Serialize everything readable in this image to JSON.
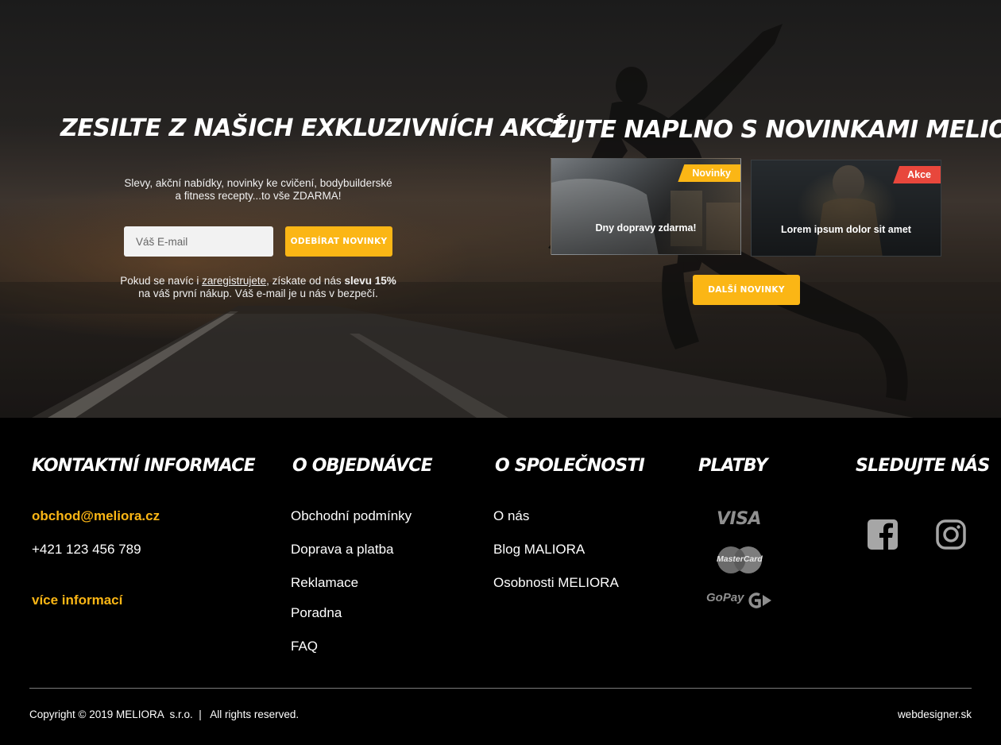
{
  "hero": {
    "left": {
      "title": "Zesilte z našich exkluzivních akcí",
      "description_line1": "Slevy, akční nabídky, novinky ke cvičení, bodybuilderské",
      "description_line2": "a fitness recepty...to vše ZDARMA!",
      "email_placeholder": "Váš E-mail",
      "subscribe_label": "Odebírat novinky",
      "note_prefix": "Pokud se navíc i ",
      "note_link": "zaregistrujete",
      "note_middle": ", získate od nás ",
      "note_bold": "slevu 15%",
      "note_line2": "na váš první nákup. Váš e-mail je u nás v bezpečí."
    },
    "right": {
      "title": "Žijte naplno s novinkami MELIORA",
      "cards": [
        {
          "tag": "Novinky",
          "tag_color": "#fbb615",
          "title": "Dny dopravy zdarma!"
        },
        {
          "tag": "Akce",
          "tag_color": "#e8473c",
          "title": "Lorem ipsum dolor sit amet"
        }
      ],
      "more_label": "Další novinky"
    }
  },
  "footer": {
    "contact": {
      "heading": "Kontaktní informace",
      "email": "obchod@meliora.cz",
      "phone": "+421 123 456 789",
      "more": "více informací"
    },
    "order": {
      "heading": "O objednávce",
      "links": [
        "Obchodní podmínky",
        "Doprava a platba",
        "Reklamace",
        "Poradna",
        "FAQ"
      ]
    },
    "company": {
      "heading": "O společnosti",
      "links": [
        "O nás",
        "Blog MALIORA",
        "Osobnosti MELIORA"
      ]
    },
    "payments": {
      "heading": "Platby",
      "icons": [
        "visa-icon",
        "mastercard-icon",
        "gopay-icon"
      ],
      "visa": "VISA",
      "mastercard": "MasterCard",
      "gopay": "GoPay"
    },
    "social": {
      "heading": "Sledujte nás",
      "icons": [
        "facebook-icon",
        "instagram-icon"
      ]
    },
    "copyright": "Copyright © 2019 MELIORA  s.r.o.  |   All rights reserved.",
    "credit": "webdesigner.sk"
  },
  "colors": {
    "accent": "#fbb615",
    "tag_red": "#e8473c",
    "background": "#000000"
  }
}
